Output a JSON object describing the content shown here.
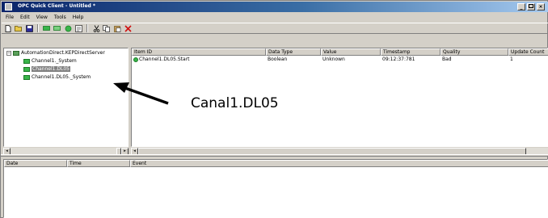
{
  "window": {
    "title": "OPC Quick Client - Untitled *",
    "controls": {
      "minimize": "_",
      "maximize": "",
      "close": "×"
    }
  },
  "menu": [
    "File",
    "Edit",
    "View",
    "Tools",
    "Help"
  ],
  "toolbar": {
    "icons": [
      "new-icon",
      "open-icon",
      "save-icon",
      "new-server-icon",
      "new-group-icon",
      "new-item-icon",
      "properties-icon",
      "cut-icon",
      "copy-icon",
      "paste-icon",
      "delete-icon"
    ]
  },
  "tree": {
    "root": "AutomationDirect.KEPDirectServer",
    "items": [
      {
        "label": "Channel1._System",
        "selected": false
      },
      {
        "label": "Channel1.DL05",
        "selected": true
      },
      {
        "label": "Channel1.DL05._System",
        "selected": false
      }
    ],
    "expander": "−"
  },
  "item_list": {
    "columns": [
      "Item ID",
      "Data Type",
      "Value",
      "Timestamp",
      "Quality",
      "Update Count"
    ],
    "rows": [
      {
        "item_id": "Channel1.DL05.Start",
        "data_type": "Boolean",
        "value": "Unknown",
        "timestamp": "09:12:37:781",
        "quality": "Bad",
        "update_count": "1"
      }
    ]
  },
  "log": {
    "columns": [
      "Date",
      "Time",
      "Event"
    ]
  },
  "annotation": {
    "label": "Canal1.DL05"
  },
  "colors": {
    "titlebar_start": "#0a246a",
    "titlebar_end": "#a6caf0",
    "item_icon": "#39b54a",
    "selection": "#808080"
  }
}
